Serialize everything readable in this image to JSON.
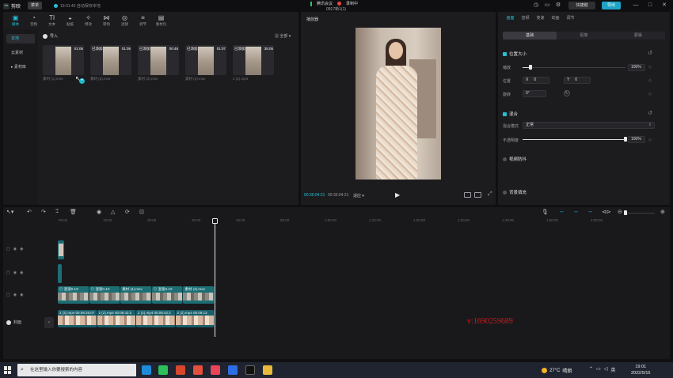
{
  "app": {
    "logo_text": "剪映",
    "menu_label": "菜单",
    "autosave": "19:01:45 自动保存本地",
    "meeting": {
      "app_name": "腾讯会议",
      "recording": "录制中"
    },
    "project_name": "0917新1(1)",
    "shortcut_label": "快捷键",
    "export_label": "导出"
  },
  "media": {
    "toolbar": [
      {
        "icon": "▣",
        "label": "媒体",
        "active": true
      },
      {
        "icon": "◔",
        "label": "音频",
        "active": false
      },
      {
        "icon": "TI",
        "label": "文本",
        "active": false
      },
      {
        "icon": "◒",
        "label": "贴纸",
        "active": false
      },
      {
        "icon": "✧",
        "label": "特效",
        "active": false
      },
      {
        "icon": "⋈",
        "label": "转场",
        "active": false
      },
      {
        "icon": "◎",
        "label": "滤镜",
        "active": false
      },
      {
        "icon": "≡",
        "label": "调节",
        "active": false
      },
      {
        "icon": "▤",
        "label": "素材包",
        "active": false
      }
    ],
    "sidebar": [
      {
        "label": "本地",
        "active": true
      },
      {
        "label": "云素材",
        "active": false
      },
      {
        "label": "▸ 素材库",
        "active": false
      }
    ],
    "import_label": "导入",
    "sort_label": "▦ 全部 ▾",
    "clips": [
      {
        "duration": "01:06",
        "badge": "",
        "name": "素材 (1).mov"
      },
      {
        "duration": "01:05",
        "badge": "已添加",
        "name": "素材 (2).mov"
      },
      {
        "duration": "00:48",
        "badge": "已添加",
        "name": "素材 (3).mov"
      },
      {
        "duration": "01:07",
        "badge": "已添加",
        "name": "素材 (4).mov"
      },
      {
        "duration": "35:05",
        "badge": "已添加",
        "name": "2 (2).mp4"
      }
    ]
  },
  "player": {
    "title": "播放器",
    "time_current": "00:35:04:21",
    "time_total": "00:35:04:21",
    "ratio_label": "适应 ▾"
  },
  "props": {
    "tabs": [
      {
        "label": "画面",
        "active": true
      },
      {
        "label": "音频",
        "active": false
      },
      {
        "label": "变速",
        "active": false
      },
      {
        "label": "动画",
        "active": false
      },
      {
        "label": "调节",
        "active": false
      }
    ],
    "subtabs": [
      {
        "label": "基础",
        "active": true
      },
      {
        "label": "抠像",
        "active": false
      },
      {
        "label": "蒙版",
        "active": false
      }
    ],
    "position_size": {
      "heading": "位置大小",
      "scale_label": "缩放",
      "scale_value": "100%",
      "scale_fraction": 0.08,
      "position_label": "位置",
      "x_label": "X",
      "x_value": "0",
      "y_label": "Y",
      "y_value": "0",
      "rotate_label": "旋转",
      "rotate_value": "0°"
    },
    "blend": {
      "heading": "混合",
      "mode_label": "混合模式",
      "mode_value": "正常",
      "opacity_label": "不透明度",
      "opacity_value": "100%",
      "opacity_fraction": 1.0
    },
    "stabilize_heading": "视频防抖",
    "background_heading": "背景填充"
  },
  "timeline": {
    "ticks": [
      "00:00",
      "10:00",
      "20:00",
      "30:00",
      "40:00",
      "50:00",
      "1:00:00",
      "1:10:00",
      "1:20:00",
      "1:30:00",
      "1:40:00",
      "1:50:00",
      "2:00:00"
    ],
    "text_clips": [
      "◎ 混速0.1X",
      "◎ 混速0.1X",
      "素材 (4).mov",
      "◎ 混速0.1X",
      "素材 (4).mov"
    ],
    "video_clips": [
      "2 (2).mp4",
      "00:09:25:07",
      "2 (2).mp4",
      "00:08:42:2",
      "2 (2).mp4",
      "00:08:42:2",
      "2 (2).mp4",
      "00:09:13"
    ],
    "cover_label": "封面"
  },
  "watermark": "v:1690259689",
  "taskbar": {
    "search_placeholder": "在这里输入你要搜索的内容",
    "temperature": "27°C",
    "weather": "晴朗",
    "ime": "英",
    "time": "19:01",
    "date": "2022/9/15"
  },
  "colors": {
    "accent": "#22c1d6",
    "export": "#1fa3c5",
    "clip_teal": "#1c6e74",
    "watermark_red": "#d21a1a"
  }
}
